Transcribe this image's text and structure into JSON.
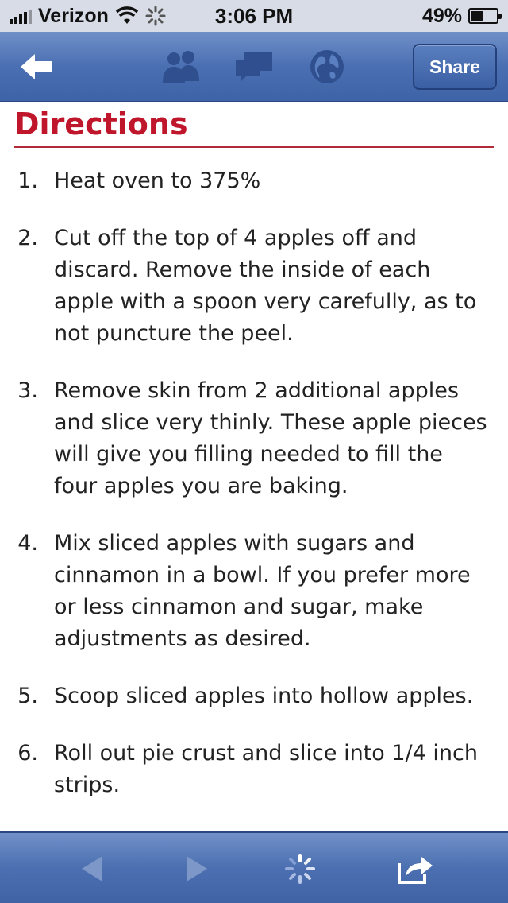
{
  "status_bar": {
    "carrier": "Verizon",
    "time": "3:06 PM",
    "battery_percent_label": "49%",
    "battery_level": 0.49
  },
  "nav": {
    "share_label": "Share",
    "icons": [
      "back-arrow-icon",
      "people-icon",
      "chat-bubbles-icon",
      "globe-icon"
    ]
  },
  "content": {
    "heading": "Directions",
    "steps": [
      {
        "num": "1.",
        "text": "Heat oven to 375%"
      },
      {
        "num": "2.",
        "text": "Cut off the top of 4 apples off and discard. Remove the inside of each apple with a spoon very carefully, as to not puncture the peel."
      },
      {
        "num": "3.",
        "text": "Remove skin from 2 additional apples and slice very thinly. These apple pieces will give you filling needed to fill the four apples you are baking."
      },
      {
        "num": "4.",
        "text": "Mix sliced apples with sugars and cinnamon in a bowl. If you prefer more or less cinnamon and sugar, make adjustments as desired."
      },
      {
        "num": "5.",
        "text": "Scoop sliced apples into hollow apples."
      },
      {
        "num": "6.",
        "text": "Roll out pie crust and slice into 1/4 inch strips."
      }
    ]
  },
  "toolbar": {
    "icons": [
      "browser-back-icon",
      "browser-forward-icon",
      "loading-spinner-icon",
      "share-action-icon"
    ]
  },
  "colors": {
    "heading": "#c0162c",
    "nav_blue": "#4a6fb2"
  }
}
